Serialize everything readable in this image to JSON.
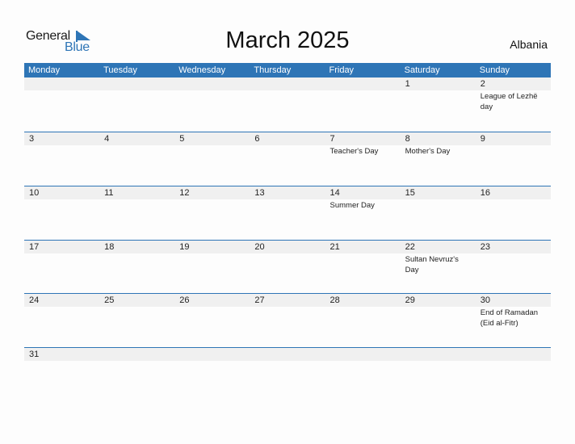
{
  "logo": {
    "word1": "General",
    "word2": "Blue"
  },
  "title": "March 2025",
  "country": "Albania",
  "colors": {
    "accent": "#2e75b6",
    "band": "#f0f0f0"
  },
  "weekdays": [
    "Monday",
    "Tuesday",
    "Wednesday",
    "Thursday",
    "Friday",
    "Saturday",
    "Sunday"
  ],
  "weeks": [
    [
      {
        "day": "",
        "event": ""
      },
      {
        "day": "",
        "event": ""
      },
      {
        "day": "",
        "event": ""
      },
      {
        "day": "",
        "event": ""
      },
      {
        "day": "",
        "event": ""
      },
      {
        "day": "1",
        "event": ""
      },
      {
        "day": "2",
        "event": "League of Lezhë day"
      }
    ],
    [
      {
        "day": "3",
        "event": ""
      },
      {
        "day": "4",
        "event": ""
      },
      {
        "day": "5",
        "event": ""
      },
      {
        "day": "6",
        "event": ""
      },
      {
        "day": "7",
        "event": "Teacher's Day"
      },
      {
        "day": "8",
        "event": "Mother's Day"
      },
      {
        "day": "9",
        "event": ""
      }
    ],
    [
      {
        "day": "10",
        "event": ""
      },
      {
        "day": "11",
        "event": ""
      },
      {
        "day": "12",
        "event": ""
      },
      {
        "day": "13",
        "event": ""
      },
      {
        "day": "14",
        "event": "Summer Day"
      },
      {
        "day": "15",
        "event": ""
      },
      {
        "day": "16",
        "event": ""
      }
    ],
    [
      {
        "day": "17",
        "event": ""
      },
      {
        "day": "18",
        "event": ""
      },
      {
        "day": "19",
        "event": ""
      },
      {
        "day": "20",
        "event": ""
      },
      {
        "day": "21",
        "event": ""
      },
      {
        "day": "22",
        "event": "Sultan Nevruz's Day"
      },
      {
        "day": "23",
        "event": ""
      }
    ],
    [
      {
        "day": "24",
        "event": ""
      },
      {
        "day": "25",
        "event": ""
      },
      {
        "day": "26",
        "event": ""
      },
      {
        "day": "27",
        "event": ""
      },
      {
        "day": "28",
        "event": ""
      },
      {
        "day": "29",
        "event": ""
      },
      {
        "day": "30",
        "event": "End of Ramadan (Eid al-Fitr)"
      }
    ],
    [
      {
        "day": "31",
        "event": ""
      },
      {
        "day": "",
        "event": ""
      },
      {
        "day": "",
        "event": ""
      },
      {
        "day": "",
        "event": ""
      },
      {
        "day": "",
        "event": ""
      },
      {
        "day": "",
        "event": ""
      },
      {
        "day": "",
        "event": ""
      }
    ]
  ]
}
